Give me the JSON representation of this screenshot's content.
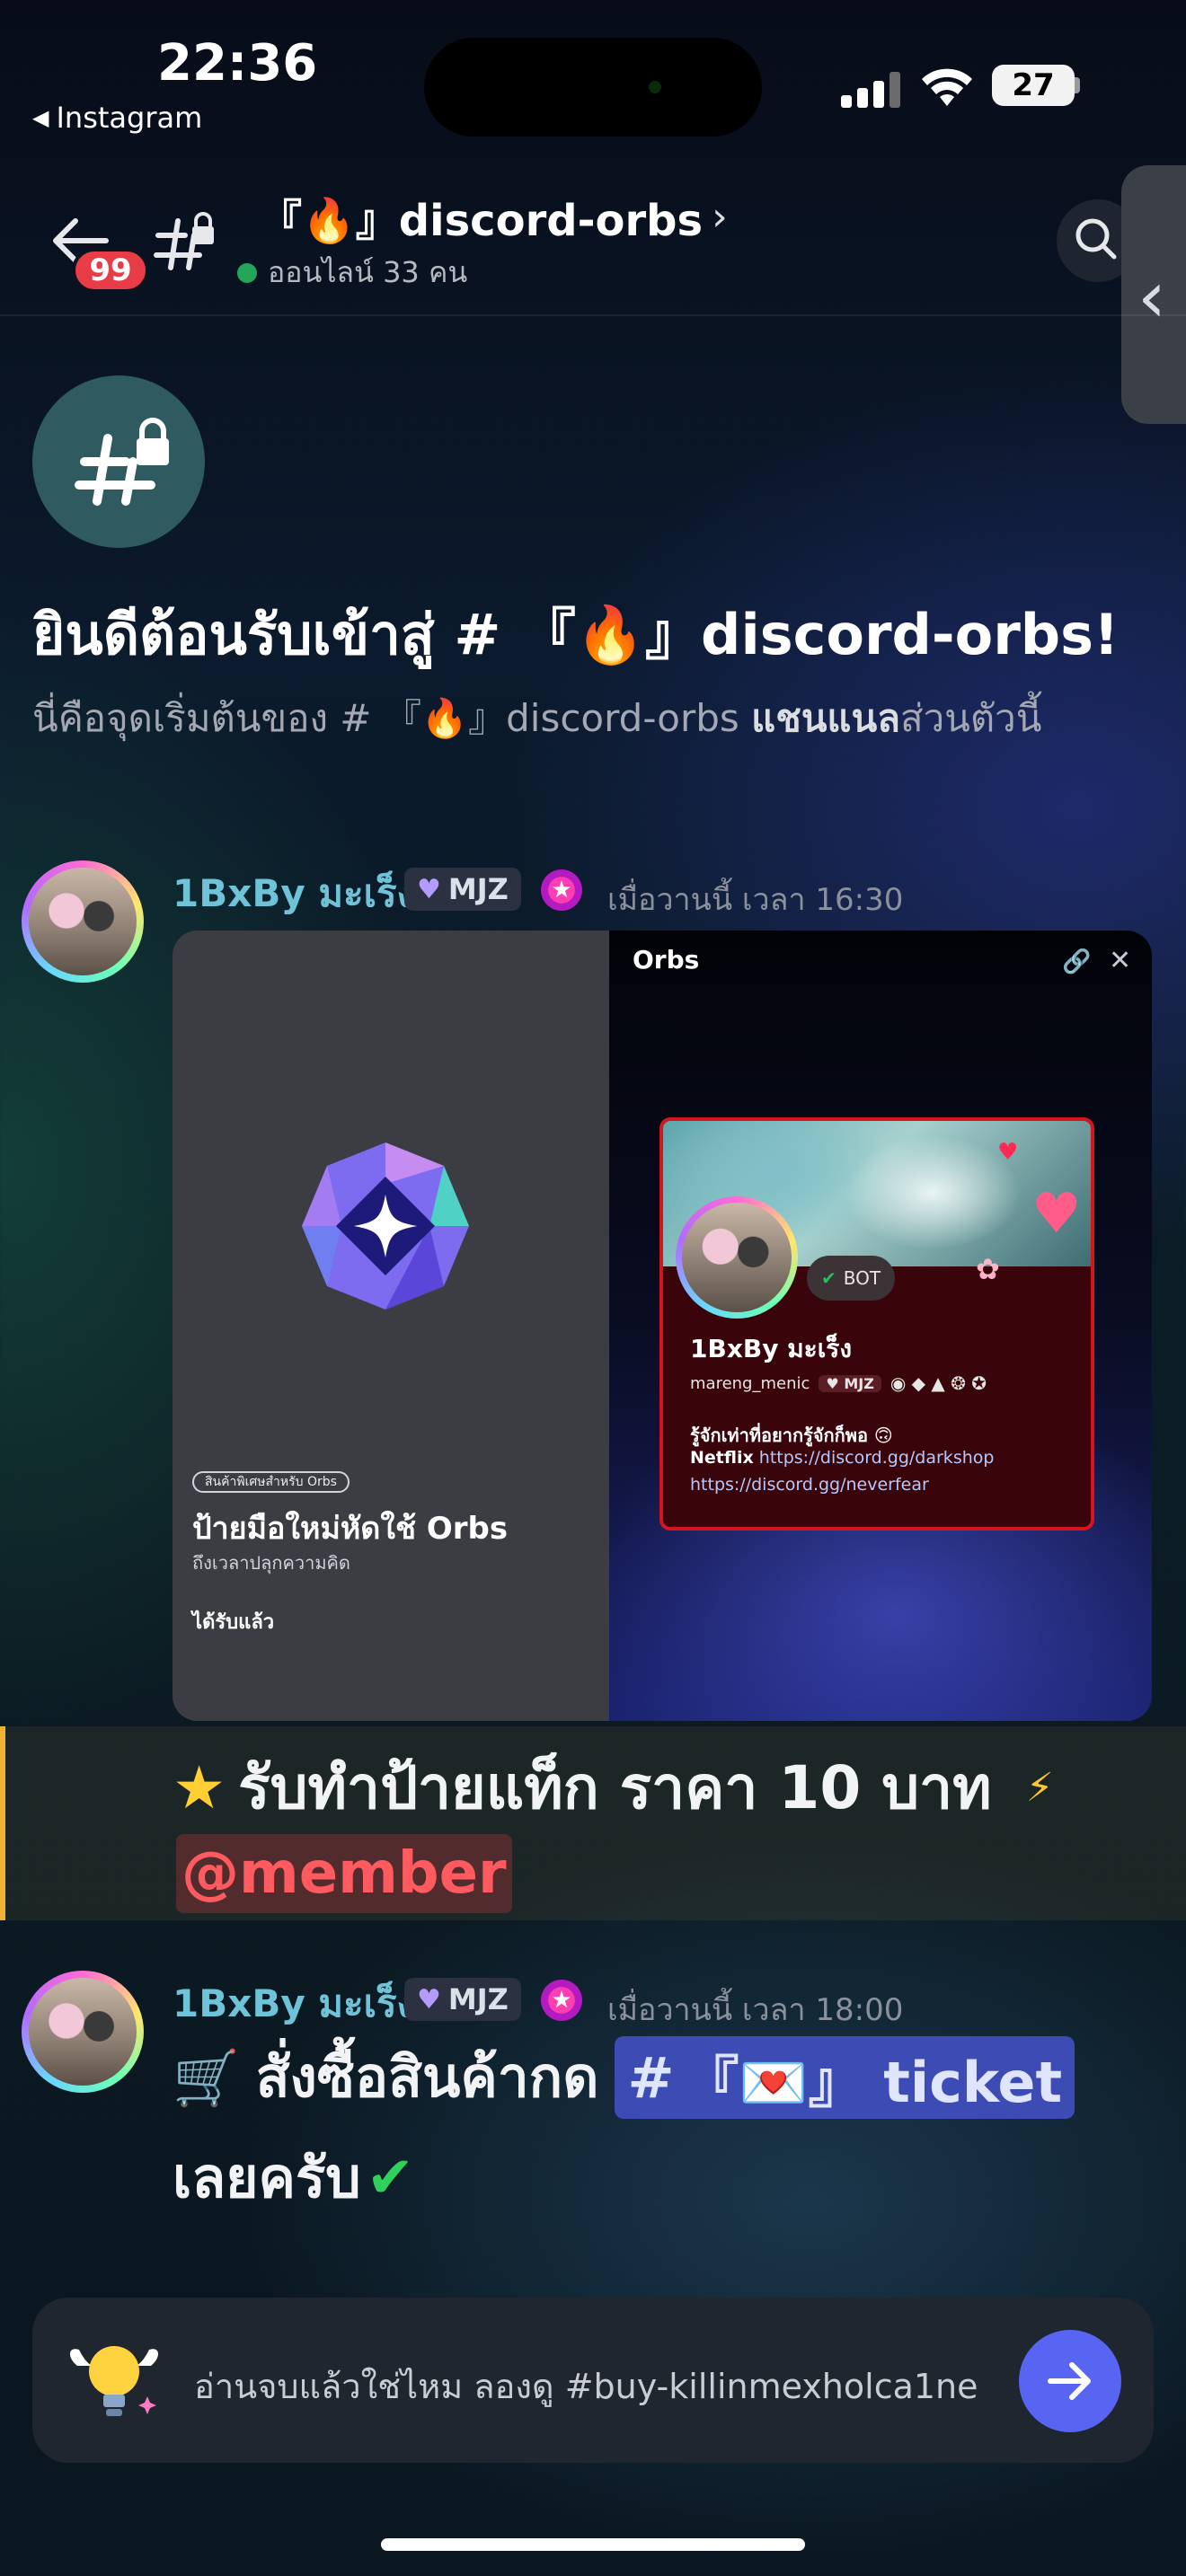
{
  "status_bar": {
    "time": "22:36",
    "back_app": "Instagram",
    "battery": "27"
  },
  "header": {
    "unread_badge": "99",
    "channel_title": "『🔥』discord-orbs",
    "online_text": "ออนไลน์ 33 คน"
  },
  "welcome": {
    "title": "ยินดีต้อนรับเข้าสู่ # 『🔥』discord-orbs!",
    "subtitle_pre": "นี่คือจุดเริ่มต้นของ # 『🔥』discord-orbs ",
    "subtitle_bold": "แชนแนล",
    "subtitle_post": "ส่วนตัวนี้"
  },
  "message1": {
    "username": "1BxBy มะเร็ง",
    "role": "MJZ",
    "timestamp": "เมื่อวานนี้ เวลา 16:30",
    "embed": {
      "badge": "สินค้าพิเศษสำหรับ Orbs",
      "title": "ป้ายมือใหม่หัดใช้ Orbs",
      "subtitle": "ถึงเวลาปลุกความคิด",
      "received": "ได้รับแล้ว",
      "panel_title": "Orbs",
      "profile": {
        "bot_label": "BOT",
        "name": "1BxBy มะเร็ง",
        "handle": "mareng_menic",
        "role": "MJZ",
        "bio_line1": "รู้จักเท่าที่อยากรู้จักก็พอ 🙃",
        "bio_line2_label": "Netflix",
        "bio_line2_link": "https://discord.gg/darkshop",
        "bio_line3": "https://discord.gg/neverfear"
      }
    }
  },
  "highlighted_message": {
    "text": "รับทำป้ายแท็ก ราคา 10 บาท",
    "mention": "@member"
  },
  "message2": {
    "username": "1BxBy มะเร็ง",
    "role": "MJZ",
    "timestamp": "เมื่อวานนี้ เวลา 18:00",
    "text_line1": "สั่งซื้อสินค้ากด",
    "channel_hash": "#",
    "channel_mention": "『💌』 ticket",
    "text_line2": "เลยครับ"
  },
  "input": {
    "prompt": "อ่านจบแล้วใช่ไหม ลองดู #buy-killinmexholca1ne"
  },
  "colors": {
    "accent": "#5865f2",
    "online": "#23a55a",
    "username": "#6fc3d9",
    "mention_bg": "#3c4cb4",
    "badge_red": "#e83c46",
    "highlight_bar": "#f0b232"
  }
}
